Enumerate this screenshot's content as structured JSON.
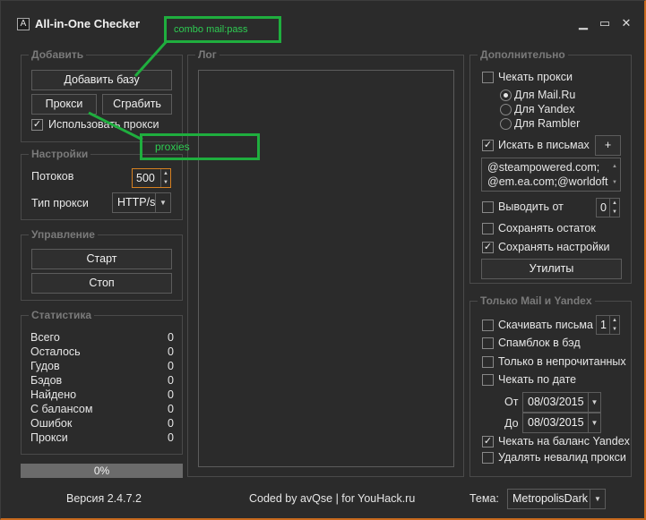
{
  "window": {
    "title": "All-in-One Checker",
    "icon_glyph": "A",
    "controls": {
      "minimize": "▁",
      "maximize": "▭",
      "close": "✕"
    }
  },
  "add_group": {
    "label": "Добавить",
    "add_base_label": "Добавить базу",
    "proxy_label": "Прокси",
    "grab_label": "Сграбить",
    "use_proxy_label": "Использовать прокси",
    "use_proxy_checked": "✓"
  },
  "settings_group": {
    "label": "Настройки",
    "threads_label": "Потоков",
    "threads_value": "500",
    "proxy_type_label": "Тип прокси",
    "proxy_type_value": "HTTP/s"
  },
  "control_group": {
    "label": "Управление",
    "start_label": "Старт",
    "stop_label": "Стоп"
  },
  "stats_group": {
    "label": "Статистика",
    "rows": [
      {
        "k": "Всего",
        "v": "0"
      },
      {
        "k": "Осталось",
        "v": "0"
      },
      {
        "k": "Гудов",
        "v": "0"
      },
      {
        "k": "Бэдов",
        "v": "0"
      },
      {
        "k": "Найдено",
        "v": "0"
      },
      {
        "k": "С балансом",
        "v": "0"
      },
      {
        "k": "Ошибок",
        "v": "0"
      },
      {
        "k": "Прокси",
        "v": "0"
      }
    ]
  },
  "progress": {
    "text": "0%",
    "value": 0
  },
  "log_group": {
    "label": "Лог"
  },
  "extra_group": {
    "label": "Дополнительно",
    "check_proxy_label": "Чекать прокси",
    "radio_mailru": "Для Mail.Ru",
    "radio_yandex": "Для Yandex",
    "radio_rambler": "Для Rambler",
    "search_in_mail_label": "Искать в письмах",
    "search_checked": "✓",
    "add_plus": "+",
    "search_text_line1": "@steampowered.com;",
    "search_text_line2": "@em.ea.com;@worldoft",
    "output_from_label": "Выводить от",
    "output_from_value": "0",
    "save_rest_label": "Сохранять остаток",
    "save_settings_label": "Сохранять настройки",
    "save_settings_checked": "✓",
    "utilities_label": "Утилиты"
  },
  "mail_group": {
    "label": "Только Mail и Yandex",
    "download_label": "Скачивать письма",
    "download_value": "1",
    "spam_label": "Спамблок в бэд",
    "unread_label": "Только в непрочитанных",
    "by_date_label": "Чекать по дате",
    "from_label": "От",
    "from_value": "08/03/2015",
    "to_label": "До",
    "to_value": "08/03/2015",
    "balance_label": "Чекать на баланс Yandex",
    "balance_checked": "✓",
    "delete_invalid_label": "Удалять невалид прокси"
  },
  "footer": {
    "version": "Версия 2.4.7.2",
    "coded_by": "Coded by avQse | for YouHack.ru",
    "theme_label": "Тема:",
    "theme_value": "MetropolisDark"
  },
  "annotations": {
    "combo_text": "combo mail:pass",
    "proxies_text": "proxies",
    "color": "#1fae3e"
  }
}
